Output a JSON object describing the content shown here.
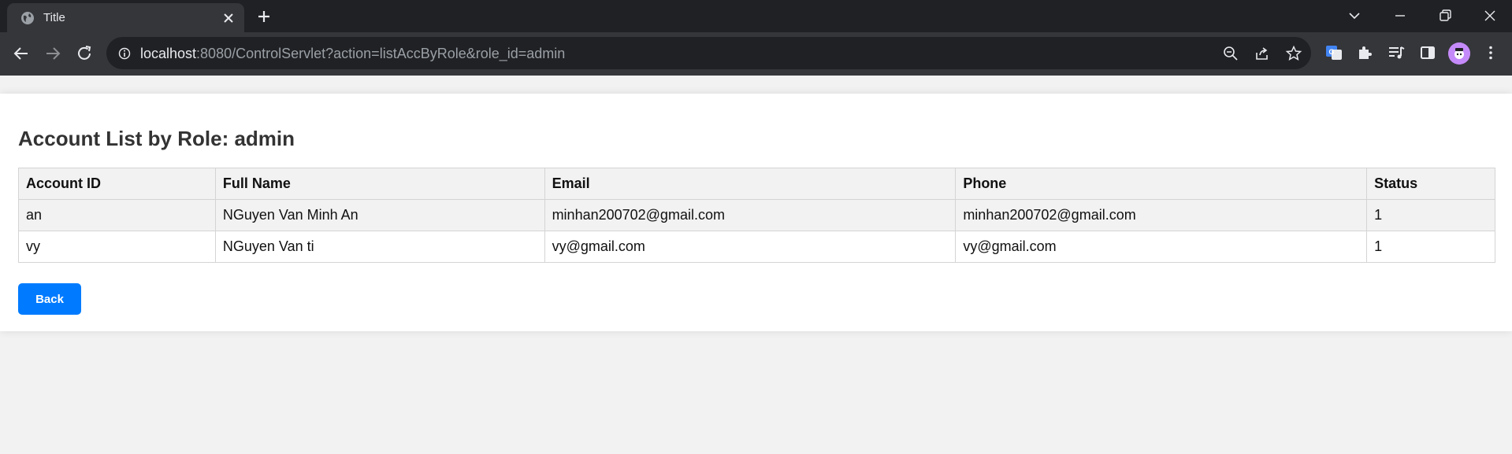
{
  "browser": {
    "tab_title": "Title",
    "url_host": "localhost",
    "url_rest": ":8080/ControlServlet?action=listAccByRole&role_id=admin"
  },
  "page": {
    "title": "Account List by Role: admin",
    "back_label": "Back"
  },
  "table": {
    "headers": [
      "Account ID",
      "Full Name",
      "Email",
      "Phone",
      "Status"
    ],
    "rows": [
      [
        "an",
        "NGuyen Van Minh An",
        "minhan200702@gmail.com",
        "minhan200702@gmail.com",
        "1"
      ],
      [
        "vy",
        "NGuyen Van ti",
        "vy@gmail.com",
        "vy@gmail.com",
        "1"
      ]
    ]
  },
  "colors": {
    "accent": "#007bff",
    "chrome_dark": "#202124",
    "chrome_toolbar": "#35363a"
  }
}
